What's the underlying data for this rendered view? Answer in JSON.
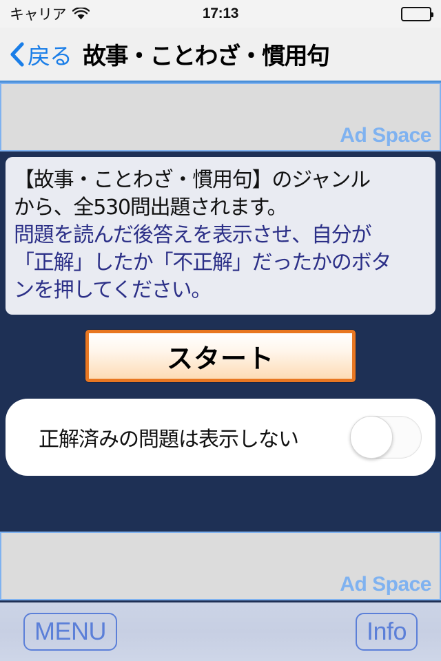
{
  "statusbar": {
    "carrier": "キャリア",
    "time": "17:13",
    "wifi_icon": "wifi-icon",
    "battery_icon": "battery-full-icon"
  },
  "navbar": {
    "back_icon": "chevron-left-icon",
    "back_label": "戻る",
    "title": "故事・ことわざ・慣用句"
  },
  "ads": {
    "top_label": "Ad Space",
    "bottom_label": "Ad Space",
    "text_color": "#7fb2f0",
    "background_color": "#dcdcdc"
  },
  "description": {
    "line1": "【故事・ことわざ・慣用句】のジャンル",
    "line2": "から、全530問出題されます。",
    "line3": "問題を読んだ後答えを表示させ、自分が",
    "line4": "「正解」したか「不正解」だったかのボタ",
    "line5": "ンを押してください。",
    "black_color": "#111111",
    "blue_color": "#2b2f87"
  },
  "start_button": {
    "label": "スタート",
    "border_color": "#e87722"
  },
  "toggle_row": {
    "label": "正解済みの問題は表示しない",
    "state": "off"
  },
  "toolbar": {
    "menu_label": "MENU",
    "info_label": "Info",
    "accent_color": "#5b7fd8"
  },
  "theme": {
    "background_navy": "#1e3055",
    "panel_background": "#e9ebf2"
  }
}
